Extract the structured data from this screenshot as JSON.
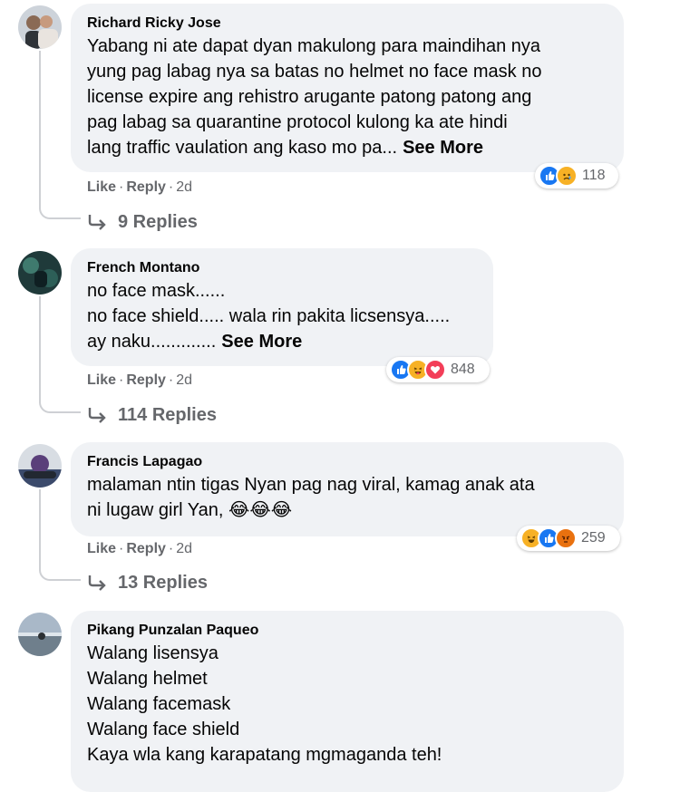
{
  "comments": [
    {
      "author": "Richard Ricky Jose",
      "text": "Yabang ni ate dapat dyan makulong para maindihan nya\nyung pag labag nya sa batas no helmet no face mask no\nlicense expire ang rehistro arugante patong patong ang\npag labag sa quarantine protocol kulong ka ate hindi\nlang traffic vaulation ang kaso mo pa...",
      "see_more": "See More",
      "like": "Like",
      "reply": "Reply",
      "time": "2d",
      "reactions": [
        "like",
        "sad"
      ],
      "reaction_count": "118",
      "replies": "9 Replies"
    },
    {
      "author": "French Montano",
      "text": "no face mask......\nno face shield..... wala rin pakita licsensya.....\nay naku.............",
      "see_more": "See More",
      "like": "Like",
      "reply": "Reply",
      "time": "2d",
      "reactions": [
        "like",
        "haha-tongue",
        "love"
      ],
      "reaction_count": "848",
      "replies": "114 Replies"
    },
    {
      "author": "Francis Lapagao",
      "text": "malaman ntin tigas Nyan pag nag viral, kamag anak ata\nni lugaw girl Yan,",
      "emojis": "😂😂😂",
      "like": "Like",
      "reply": "Reply",
      "time": "2d",
      "reactions": [
        "haha",
        "like",
        "angry"
      ],
      "reaction_count": "259",
      "replies": "13 Replies"
    },
    {
      "author": "Pikang Punzalan Paqueo",
      "text": "Walang lisensya\nWalang helmet\nWalang facemask\nWalang face shield\nKaya wla kang karapatang mgmaganda teh!"
    }
  ],
  "colors": {
    "bubble": "#f0f2f5",
    "secondary_text": "#65676b",
    "like_blue": "#1877f2",
    "love_red": "#f33e58",
    "haha_yellow": "#f7b125",
    "angry_orange": "#e9710f"
  }
}
